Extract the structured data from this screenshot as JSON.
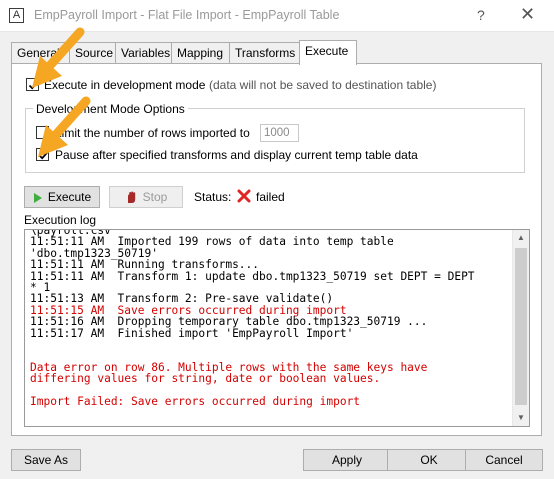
{
  "window": {
    "app_icon": "A",
    "title": "EmpPayroll Import - Flat File Import - EmpPayroll Table",
    "help_label": "?",
    "close_label": "✕"
  },
  "tabs": [
    {
      "label": "General"
    },
    {
      "label": "Source"
    },
    {
      "label": "Variables"
    },
    {
      "label": "Mapping"
    },
    {
      "label": "Transforms"
    },
    {
      "label": "Execute",
      "active": true
    }
  ],
  "execute": {
    "dev_mode_label": "Execute in development mode",
    "dev_mode_note": "(data will not be saved to destination table)",
    "dev_mode_checked": true
  },
  "dev_options": {
    "group_title": "Development Mode Options",
    "limit_label": "Limit the number of rows imported to",
    "limit_checked": false,
    "limit_value": "1000",
    "pause_label": "Pause after specified transforms and display current temp table data",
    "pause_checked": true
  },
  "actions": {
    "execute_label": "Execute",
    "stop_label": "Stop",
    "status_label": "Status:",
    "status_value": "failed"
  },
  "log": {
    "label": "Execution log",
    "lines": [
      {
        "text": "\\payroll.csv",
        "error": false
      },
      {
        "text": "11:51:11 AM  Imported 199 rows of data into temp table",
        "error": false
      },
      {
        "text": "'dbo.tmp1323_50719'",
        "error": false
      },
      {
        "text": "11:51:11 AM  Running transforms...",
        "error": false
      },
      {
        "text": "11:51:11 AM  Transform 1: update dbo.tmp1323_50719 set DEPT = DEPT",
        "error": false
      },
      {
        "text": "* 1",
        "error": false
      },
      {
        "text": "11:51:13 AM  Transform 2: Pre-save validate()",
        "error": false
      },
      {
        "text": "11:51:15 AM  Save errors occurred during import",
        "error": true
      },
      {
        "text": "11:51:16 AM  Dropping temporary table dbo.tmp1323_50719 ...",
        "error": false
      },
      {
        "text": "11:51:17 AM  Finished import 'EmpPayroll Import'",
        "error": false
      },
      {
        "text": "",
        "error": false
      },
      {
        "text": "",
        "error": false
      },
      {
        "text": "Data error on row 86. Multiple rows with the same keys have",
        "error": true
      },
      {
        "text": "differing values for string, date or boolean values.",
        "error": true
      },
      {
        "text": "",
        "error": false
      },
      {
        "text": "Import Failed: Save errors occurred during import",
        "error": true
      }
    ]
  },
  "footer": {
    "save_as_label": "Save As",
    "apply_label": "Apply",
    "ok_label": "OK",
    "cancel_label": "Cancel"
  },
  "colors": {
    "error_text": "#d40000",
    "annotation_arrow": "#f5a623"
  }
}
